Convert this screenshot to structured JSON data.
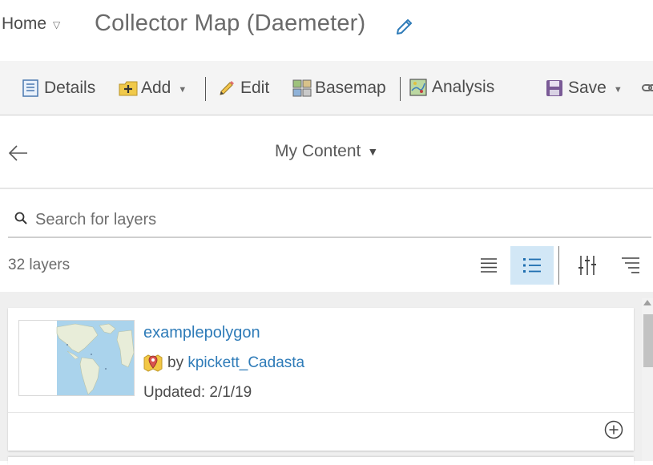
{
  "header": {
    "home_label": "Home",
    "map_title": "Collector Map (Daemeter)"
  },
  "toolbar": {
    "details_label": "Details",
    "add_label": "Add",
    "edit_label": "Edit",
    "basemap_label": "Basemap",
    "analysis_label": "Analysis",
    "save_label": "Save"
  },
  "content": {
    "source_label": "My Content",
    "search_placeholder": "Search for layers",
    "layer_count": "32 layers"
  },
  "results": [
    {
      "title": "examplepolygon",
      "by_prefix": "by",
      "owner": "kpickett_Cadasta",
      "updated": "Updated: 2/1/19"
    }
  ],
  "colors": {
    "link": "#2e7bb8",
    "active_view_bg": "#d2e7f6",
    "toolbar_bg": "#f4f4f4"
  }
}
